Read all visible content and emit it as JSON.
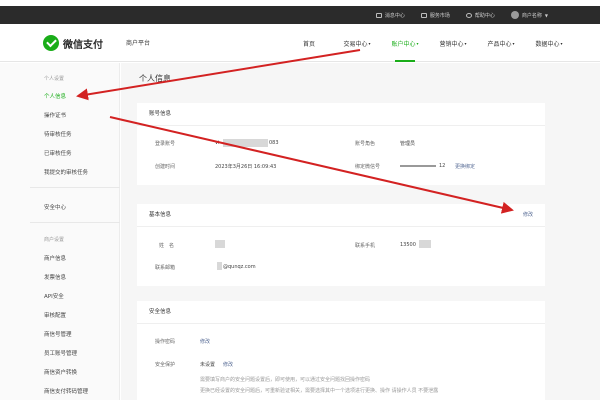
{
  "topbar": {
    "items": [
      {
        "label": "消息中心",
        "icon": "message-icon"
      },
      {
        "label": "服务市场",
        "icon": "market-icon"
      },
      {
        "label": "帮助中心",
        "icon": "help-icon"
      },
      {
        "label": "商户名称",
        "icon": "avatar"
      }
    ]
  },
  "header": {
    "logo_text": "微信支付",
    "subtitle": "商户平台",
    "nav": [
      {
        "label": "首页"
      },
      {
        "label": "交易中心"
      },
      {
        "label": "账户中心"
      },
      {
        "label": "营销中心"
      },
      {
        "label": "产品中心"
      },
      {
        "label": "数据中心"
      }
    ],
    "active_nav": "账户中心"
  },
  "sidebar": {
    "group1": "个人设置",
    "group1_items": [
      "个人信息",
      "操作证书",
      "待审核任务",
      "已审核任务",
      "我提交的审核任务"
    ],
    "security": "安全中心",
    "group2": "商户设置",
    "group2_items": [
      "商户信息",
      "发票信息",
      "API安全",
      "审核配置",
      "商信号管理",
      "员工账号管理",
      "商信资户转换",
      "商信支付转码管理"
    ]
  },
  "main": {
    "page_title": "个人信息",
    "account": {
      "title": "账号信息",
      "login_label": "登录账号",
      "login_value_prefix": "vi",
      "login_value_suffix": "083",
      "account_label": "账号角色",
      "account_value": "管理员",
      "created_label": "创建时间",
      "created_value": "2023年3月26日 16:09:43",
      "bind_label": "绑定微信号",
      "bind_value_suffix": "12",
      "bind_link": "更换绑定"
    },
    "basic": {
      "title": "基本信息",
      "edit_link": "修改",
      "name_label": "姓　名",
      "phone_label": "联系手机",
      "phone_value_prefix": "13500",
      "email_label": "联系邮箱",
      "email_value": "@qunqz.com"
    },
    "security": {
      "title": "安全信息",
      "password_label": "操作密码",
      "password_link": "修改",
      "question_label": "安全保护",
      "question_value": "未设置",
      "question_link": "修改",
      "desc1": "需要填写商户的安全问题设置后，即可使用，可以通过安全问题找回操作密码",
      "desc2": "更换已经设置的安全问题后，可重新验证相关，需要选择其中一个选项进行更换、操作 请操作人员 不要泄露"
    }
  }
}
